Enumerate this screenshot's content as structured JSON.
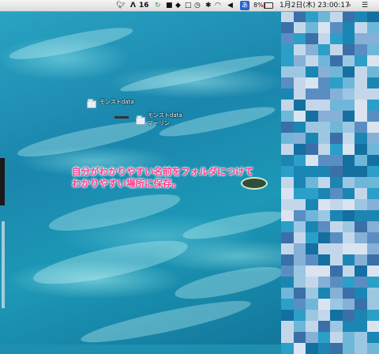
{
  "menubar": {
    "app_icon": "bird-icon",
    "adobe_label": "16",
    "battery_percent": "8%",
    "ime_label": "あ",
    "clock": "1月2日(木) 23:00:17"
  },
  "desktop": {
    "icons": [
      {
        "label": "モンストdata"
      },
      {
        "label_line1": "モンストdata",
        "label_line2": "マーリン"
      }
    ]
  },
  "annotation": {
    "line1": "自分がわかりやすい名前をフォルダにつけて",
    "line2": "わかりやすい場所に保存。"
  },
  "colors": {
    "annotation": "#ff3d8b",
    "menubar": "#e8e8e8",
    "ocean": "#1f8fb0"
  }
}
